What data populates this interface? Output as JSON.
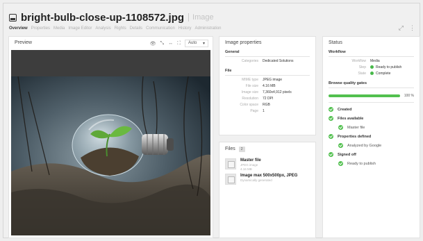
{
  "header": {
    "title": "bright-bulb-close-up-1108572.jpg",
    "badge": "Image",
    "expand_icon": "expand-icon",
    "menu_icon": "kebab-menu-icon"
  },
  "tabs": [
    {
      "label": "Overview",
      "active": true
    },
    {
      "label": "Properties"
    },
    {
      "label": "Media"
    },
    {
      "label": "Image Editor"
    },
    {
      "label": "Analysis"
    },
    {
      "label": "Rights"
    },
    {
      "label": "Details"
    },
    {
      "label": "Communication"
    },
    {
      "label": "History"
    },
    {
      "label": "Administration"
    }
  ],
  "preview": {
    "title": "Preview",
    "zoom": "Auto",
    "tools": [
      "eye-icon",
      "fit-icon",
      "width-icon",
      "fullscreen-icon"
    ]
  },
  "properties": {
    "title": "Image properties",
    "general_label": "General",
    "general": [
      {
        "key": "Categories",
        "value": "Dedicated Solutions"
      }
    ],
    "file_label": "File",
    "file": [
      {
        "key": "MIME type",
        "value": "JPEG image"
      },
      {
        "key": "File size",
        "value": "4.16 MB"
      },
      {
        "key": "Image size",
        "value": "7,360x4,912 pixels"
      },
      {
        "key": "Resolution",
        "value": "72 DPI"
      },
      {
        "key": "Color space",
        "value": "RGB"
      },
      {
        "key": "Page",
        "value": "1"
      }
    ]
  },
  "files": {
    "title": "Files",
    "count": "2",
    "items": [
      {
        "name": "Master file",
        "line1": "JPEG image",
        "line2": "4.16 MB"
      },
      {
        "name": "Image max 500x500px, JPEG",
        "line1": "Dynamically generated",
        "line2": ""
      }
    ]
  },
  "status": {
    "title": "Status",
    "workflow_label": "Workflow",
    "workflow": [
      {
        "key": "Workflow",
        "value": "Media",
        "dot": false
      },
      {
        "key": "Step",
        "value": "Ready to publish",
        "dot": true
      },
      {
        "key": "State",
        "value": "Complete",
        "dot": true
      }
    ],
    "quality_label": "Browse quality gates",
    "progress": 1.0,
    "progress_text": "100 %",
    "checks": [
      {
        "label": "Created",
        "sub": false
      },
      {
        "label": "Files available",
        "sub": false
      },
      {
        "label": "Master file",
        "sub": true
      },
      {
        "label": "Properties defined",
        "sub": false
      },
      {
        "label": "Analyzed by Google",
        "sub": true
      },
      {
        "label": "Signed off",
        "sub": false
      },
      {
        "label": "Ready to publish",
        "sub": true
      }
    ]
  },
  "colors": {
    "accent": "#48b84a",
    "progress_fill": "#52c04f",
    "preview_bg": "#3d3d3d"
  }
}
